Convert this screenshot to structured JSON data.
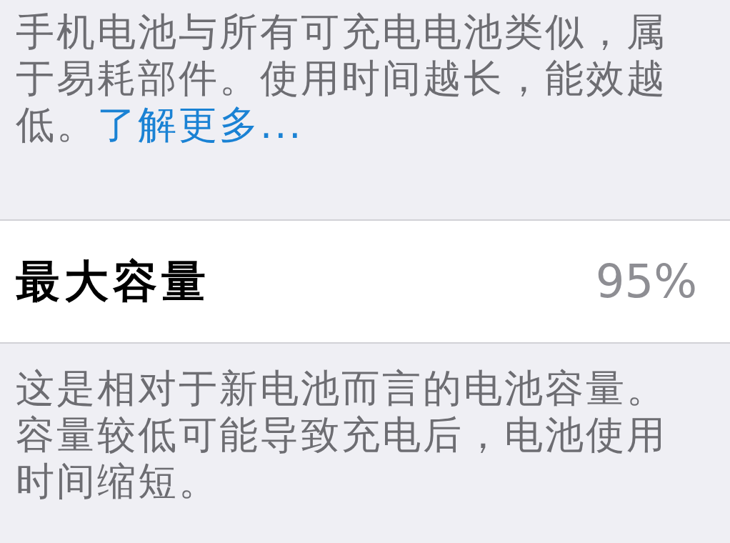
{
  "battery_note": {
    "text": "手机电池与所有可充电电池类似，属于易耗部件。使用时间越长，能效越低。",
    "link": "了解更多..."
  },
  "maximum_capacity": {
    "label": "最大容量",
    "value": "95%"
  },
  "capacity_note": "这是相对于新电池而言的电池容量。容量较低可能导致充电后，电池使用时间缩短。"
}
